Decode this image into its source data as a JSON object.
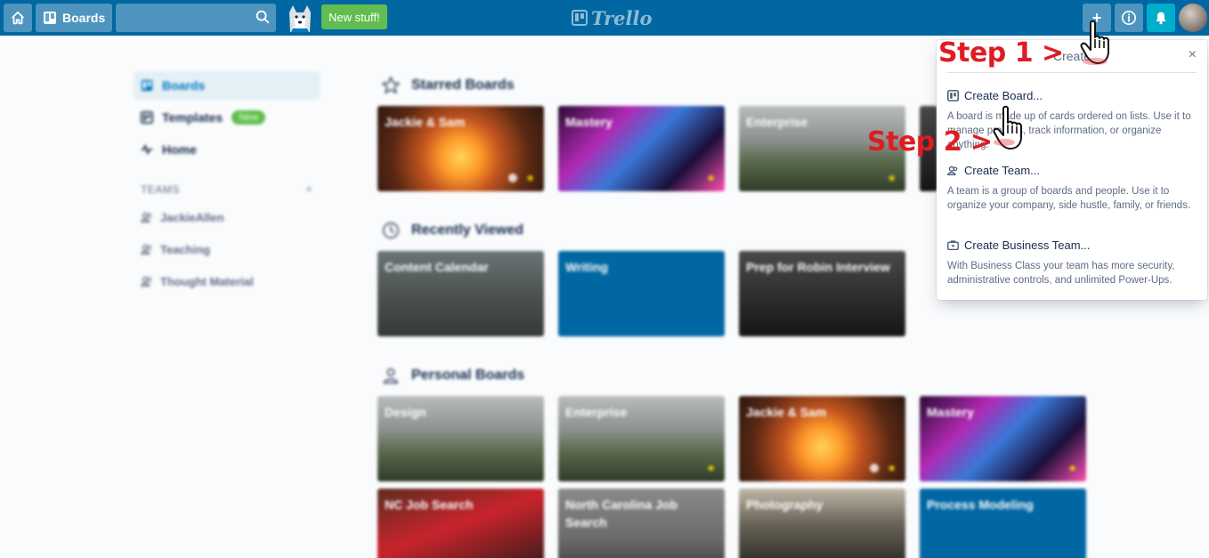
{
  "header": {
    "boards_label": "Boards",
    "new_stuff_label": "New stuff!",
    "logo_text": "Trello",
    "search_placeholder": ""
  },
  "sidebar": {
    "items": [
      {
        "label": "Boards",
        "icon": "board-icon",
        "active": true
      },
      {
        "label": "Templates",
        "icon": "template-icon",
        "badge": "New"
      },
      {
        "label": "Home",
        "icon": "activity-icon"
      }
    ],
    "teams_label": "TEAMS",
    "teams_add": "+",
    "teams": [
      {
        "label": "JackieAllen"
      },
      {
        "label": "Teaching"
      },
      {
        "label": "Thought Material"
      }
    ]
  },
  "sections": {
    "starred": {
      "title": "Starred Boards",
      "boards": [
        "Jackie & Sam",
        "Mastery",
        "Enterprise",
        ""
      ]
    },
    "recent": {
      "title": "Recently Viewed",
      "boards": [
        "Content Calendar",
        "Writing",
        "Prep for Robin Interview"
      ]
    },
    "personal": {
      "title": "Personal Boards",
      "boards": [
        "Design",
        "Enterprise",
        "Jackie & Sam",
        "Mastery",
        "NC Job Search",
        "North Carolina Job Search",
        "Photography",
        "Process Modeling"
      ]
    }
  },
  "popover": {
    "title": "Create",
    "close": "×",
    "items": [
      {
        "title": "Create Board...",
        "desc": "A board is made up of cards ordered on lists. Use it to manage projects, track information, or organize anything.",
        "icon": "board-icon"
      },
      {
        "title": "Create Team...",
        "desc": "A team is a group of boards and people. Use it to organize your company, side hustle, family, or friends.",
        "icon": "team-icon"
      },
      {
        "title": "Create Business Team...",
        "desc": "With Business Class your team has more security, administrative controls, and unlimited Power-Ups.",
        "icon": "briefcase-icon"
      }
    ]
  },
  "annotations": {
    "step1": "Step 1 >",
    "step2": "Step 2 >"
  },
  "colors": {
    "header": "#0067a3",
    "accent_green": "#61bd4f",
    "bell": "#00aecc",
    "annotation_red": "#e11b22"
  }
}
